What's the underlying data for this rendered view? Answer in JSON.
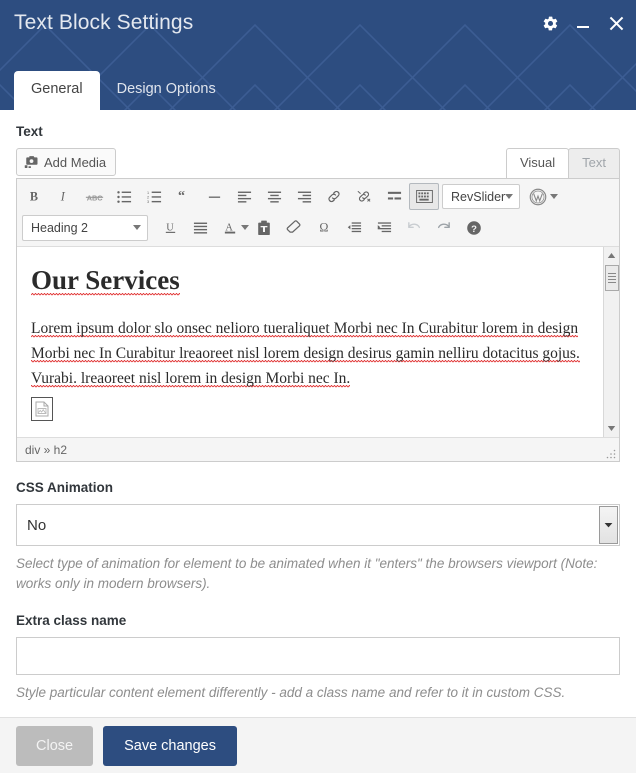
{
  "header": {
    "title": "Text Block Settings",
    "accent_color": "#2d4d80",
    "controls": [
      {
        "name": "settings-gear",
        "label": "Settings"
      },
      {
        "name": "minimize",
        "label": "Minimize"
      },
      {
        "name": "close",
        "label": "Close"
      }
    ],
    "tabs": [
      {
        "label": "General",
        "active": true
      },
      {
        "label": "Design Options",
        "active": false
      }
    ]
  },
  "text_field": {
    "label": "Text",
    "add_media_label": "Add Media",
    "editor_tabs": [
      {
        "label": "Visual",
        "active": true
      },
      {
        "label": "Text",
        "active": false
      }
    ],
    "toolbar": {
      "row1": [
        {
          "icon": "bold-icon",
          "title": "Bold"
        },
        {
          "icon": "italic-icon",
          "title": "Italic"
        },
        {
          "icon": "strikethrough-icon",
          "title": "Strikethrough"
        },
        {
          "icon": "bulleted-list-icon",
          "title": "Bulleted list"
        },
        {
          "icon": "numbered-list-icon",
          "title": "Numbered list"
        },
        {
          "icon": "blockquote-icon",
          "title": "Blockquote"
        },
        {
          "icon": "horizontal-rule-icon",
          "title": "Horizontal line"
        },
        {
          "icon": "align-left-icon",
          "title": "Align left"
        },
        {
          "icon": "align-center-icon",
          "title": "Align center"
        },
        {
          "icon": "align-right-icon",
          "title": "Align right"
        },
        {
          "icon": "insert-link-icon",
          "title": "Insert/edit link"
        },
        {
          "icon": "unlink-icon",
          "title": "Remove link"
        },
        {
          "icon": "read-more-icon",
          "title": "Insert Read More tag"
        },
        {
          "icon": "kitchen-sink-icon",
          "title": "Toolbar Toggle",
          "active": true
        }
      ],
      "revslider_label": "RevSlider",
      "wordpress_icon": "wordpress-icon",
      "format_select": "Heading 2",
      "row2": [
        {
          "icon": "underline-icon",
          "title": "Underline"
        },
        {
          "icon": "justify-icon",
          "title": "Justify"
        },
        {
          "icon": "text-color-icon",
          "title": "Text color"
        },
        {
          "icon": "paste-as-text-icon",
          "title": "Paste as text"
        },
        {
          "icon": "clear-formatting-icon",
          "title": "Clear formatting"
        },
        {
          "icon": "special-character-icon",
          "title": "Special character"
        },
        {
          "icon": "outdent-icon",
          "title": "Decrease indent"
        },
        {
          "icon": "indent-icon",
          "title": "Increase indent"
        },
        {
          "icon": "undo-icon",
          "title": "Undo",
          "disabled": true
        },
        {
          "icon": "redo-icon",
          "title": "Redo"
        },
        {
          "icon": "help-icon",
          "title": "Keyboard Shortcuts"
        }
      ]
    },
    "content": {
      "heading": "Our Services",
      "paragraph": "Lorem ipsum dolor slo onsec nelioro tueraliquet Morbi nec In Curabitur lorem in design Morbi nec In Curabitur lreaoreet nisl lorem design desirus gamin nelliru dotacitus gojus. Vurabi. lreaoreet nisl lorem in design Morbi nec In.",
      "broken_image": "broken-image-icon"
    },
    "path_status": "div » h2"
  },
  "css_animation": {
    "label": "CSS Animation",
    "value": "No",
    "options": [
      "No"
    ],
    "helper": "Select type of animation for element to be animated when it \"enters\" the browsers viewport (Note: works only in modern browsers)."
  },
  "extra_class": {
    "label": "Extra class name",
    "value": "",
    "placeholder": "",
    "helper": "Style particular content element differently - add a class name and refer to it in custom CSS."
  },
  "footer": {
    "close_label": "Close",
    "save_label": "Save changes",
    "save_color": "#2d4d80",
    "close_color": "#bcbcbc"
  }
}
